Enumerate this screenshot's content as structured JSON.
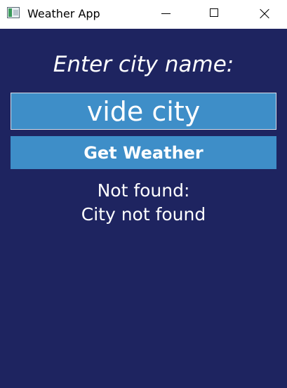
{
  "window": {
    "title": "Weather App",
    "icon": "app-window-icon",
    "controls": [
      "minimize-icon",
      "maximize-icon",
      "close-icon"
    ]
  },
  "form": {
    "prompt": "Enter city name:",
    "city_value": "vide city",
    "button_label": "Get Weather"
  },
  "result": {
    "status": "Not found:",
    "message": "City not found"
  },
  "colors": {
    "background": "#1e2460",
    "accent": "#3e8ec8",
    "text": "#ffffff"
  }
}
